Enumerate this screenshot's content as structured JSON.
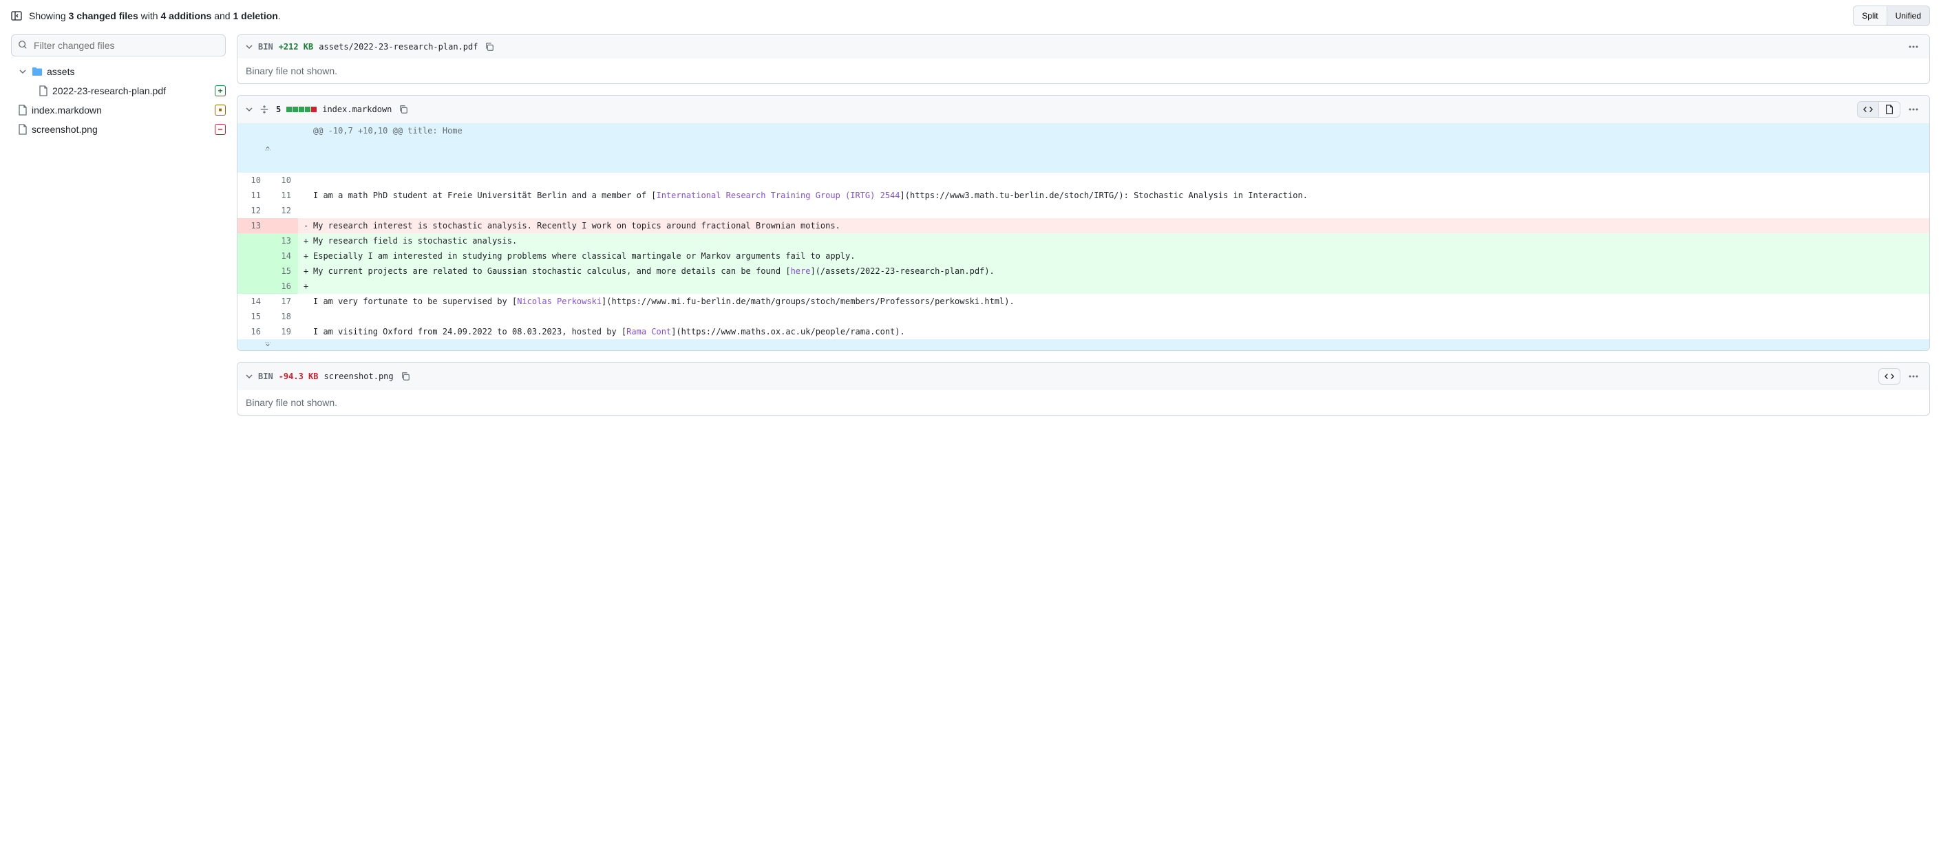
{
  "summary": {
    "prefix": "Showing ",
    "files_count": "3 changed files",
    "mid1": " with ",
    "additions": "4 additions",
    "mid2": " and ",
    "deletions": "1 deletion",
    "suffix": "."
  },
  "view_toggle": {
    "split": "Split",
    "unified": "Unified"
  },
  "filter": {
    "placeholder": "Filter changed files"
  },
  "tree": {
    "folder": "assets",
    "file1": "2022-23-research-plan.pdf",
    "file2": "index.markdown",
    "file3": "screenshot.png"
  },
  "file_a": {
    "bin": "BIN",
    "size": "+212 KB",
    "path": "assets/2022-23-research-plan.pdf",
    "body": "Binary file not shown."
  },
  "file_b": {
    "changes": "5",
    "path": "index.markdown",
    "hunk": "@@ -10,7 +10,10 @@ title: Home",
    "rows": [
      {
        "type": "ctx",
        "old": "10",
        "new": "10",
        "text": ""
      },
      {
        "type": "ctx",
        "old": "11",
        "new": "11",
        "text": "I am a math PhD student at Freie Universität Berlin and a member of [",
        "link": "International Research Training Group (IRTG) 2544",
        "text2": "](https://www3.math.tu-berlin.de/stoch/IRTG/): Stochastic Analysis in Interaction."
      },
      {
        "type": "ctx",
        "old": "12",
        "new": "12",
        "text": ""
      },
      {
        "type": "del",
        "old": "13",
        "new": "",
        "text": "My research interest is stochastic analysis. Recently I work on topics around fractional Brownian motions."
      },
      {
        "type": "add",
        "old": "",
        "new": "13",
        "text": "My research field is stochastic analysis."
      },
      {
        "type": "add",
        "old": "",
        "new": "14",
        "text": "Especially I am interested in studying problems where classical martingale or Markov arguments fail to apply."
      },
      {
        "type": "add",
        "old": "",
        "new": "15",
        "text": "My current projects are related to Gaussian stochastic calculus, and more details can be found [",
        "link": "here",
        "text2": "](/assets/2022-23-research-plan.pdf)."
      },
      {
        "type": "add",
        "old": "",
        "new": "16",
        "text": ""
      },
      {
        "type": "ctx",
        "old": "14",
        "new": "17",
        "text": "I am very fortunate to be supervised by [",
        "link": "Nicolas Perkowski",
        "text2": "](https://www.mi.fu-berlin.de/math/groups/stoch/members/Professors/perkowski.html)."
      },
      {
        "type": "ctx",
        "old": "15",
        "new": "18",
        "text": ""
      },
      {
        "type": "ctx",
        "old": "16",
        "new": "19",
        "text": "I am visiting Oxford from 24.09.2022 to 08.03.2023, hosted by [",
        "link": "Rama Cont",
        "text2": "](https://www.maths.ox.ac.uk/people/rama.cont)."
      }
    ]
  },
  "file_c": {
    "bin": "BIN",
    "size": "-94.3 KB",
    "path": "screenshot.png",
    "body": "Binary file not shown."
  }
}
